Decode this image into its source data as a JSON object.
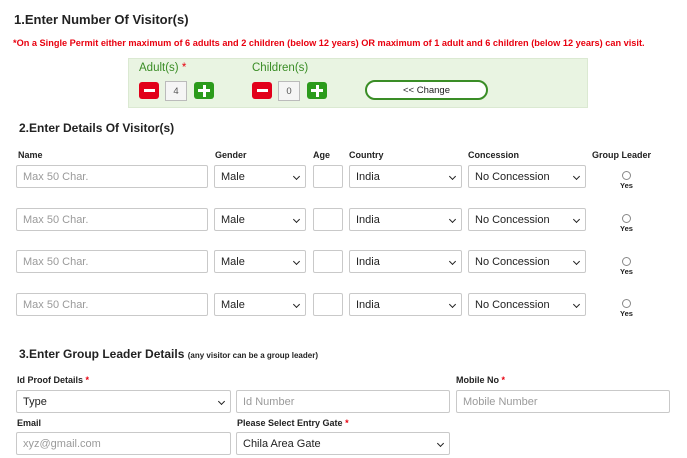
{
  "section1": {
    "title": "1.Enter Number Of Visitor(s)",
    "note": "*On a Single Permit either maximum of 6 adults and 2 children (below 12 years) OR maximum of 1 adult and 6 children (below 12 years) can visit.",
    "adults_label": "Adult(s)",
    "adults_required": "*",
    "adults_count": "4",
    "children_label": "Children(s)",
    "children_count": "0",
    "change_label": "<< Change"
  },
  "section2": {
    "title": "2.Enter Details Of Visitor(s)",
    "columns": [
      "Name",
      "Gender",
      "Age",
      "Country",
      "Concession",
      "Group Leader"
    ],
    "rows": [
      {
        "name_placeholder": "Max 50 Char.",
        "gender": "Male",
        "age": "",
        "country": "India",
        "concession": "No Concession",
        "leader_label": "Yes"
      },
      {
        "name_placeholder": "Max 50 Char.",
        "gender": "Male",
        "age": "",
        "country": "India",
        "concession": "No Concession",
        "leader_label": "Yes"
      },
      {
        "name_placeholder": "Max 50 Char.",
        "gender": "Male",
        "age": "",
        "country": "India",
        "concession": "No Concession",
        "leader_label": "Yes"
      },
      {
        "name_placeholder": "Max 50 Char.",
        "gender": "Male",
        "age": "",
        "country": "India",
        "concession": "No Concession",
        "leader_label": "Yes"
      }
    ]
  },
  "section3": {
    "title": "3.Enter Group Leader Details",
    "subtitle": "(any visitor can be a group leader)",
    "id_proof_label": "Id Proof Details",
    "id_proof_required": "*",
    "id_type_value": "Type",
    "id_number_placeholder": "Id Number",
    "mobile_label": "Mobile No",
    "mobile_required": "*",
    "mobile_placeholder": "Mobile Number",
    "email_label": "Email",
    "email_placeholder": "xyz@gmail.com",
    "gate_label": "Please Select Entry Gate",
    "gate_required": "*",
    "gate_value": "Chila Area Gate"
  },
  "colors": {
    "accent_green": "#3a8d26",
    "danger_red": "#e2001a",
    "note_red": "#e8000f",
    "panel_bg": "#e9f4e2"
  }
}
